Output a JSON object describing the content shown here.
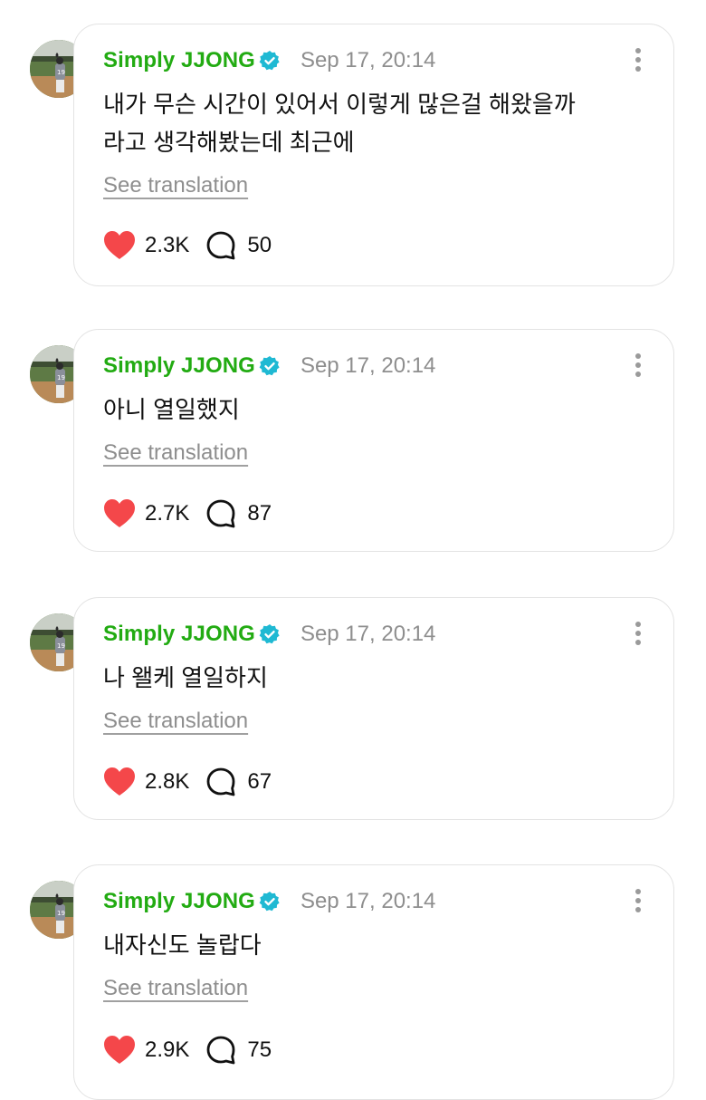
{
  "posts": [
    {
      "author": "Simply JJONG",
      "timestamp": "Sep 17, 20:14",
      "lines": [
        "내가 무슨 시간이 있어서 이렇게 많은걸 해왔을까",
        "라고 생각해봤는데 최근에"
      ],
      "translate_label": "See translation",
      "likes": "2.3K",
      "comments": "50"
    },
    {
      "author": "Simply JJONG",
      "timestamp": "Sep 17, 20:14",
      "lines": [
        "아니 열일했지"
      ],
      "translate_label": "See translation",
      "likes": "2.7K",
      "comments": "87"
    },
    {
      "author": "Simply JJONG",
      "timestamp": "Sep 17, 20:14",
      "lines": [
        "나 왤케 열일하지"
      ],
      "translate_label": "See translation",
      "likes": "2.8K",
      "comments": "67"
    },
    {
      "author": "Simply JJONG",
      "timestamp": "Sep 17, 20:14",
      "lines": [
        "내자신도 놀랍다"
      ],
      "translate_label": "See translation",
      "likes": "2.9K",
      "comments": "75"
    }
  ],
  "colors": {
    "author": "#22ab12",
    "verified": "#1fb9d3",
    "heart": "#f4474a",
    "muted": "#8e8e8e"
  },
  "icons": {
    "verified": "verified-badge-icon",
    "like": "heart-icon",
    "comment": "speech-bubble-icon",
    "more": "more-vertical-icon"
  }
}
